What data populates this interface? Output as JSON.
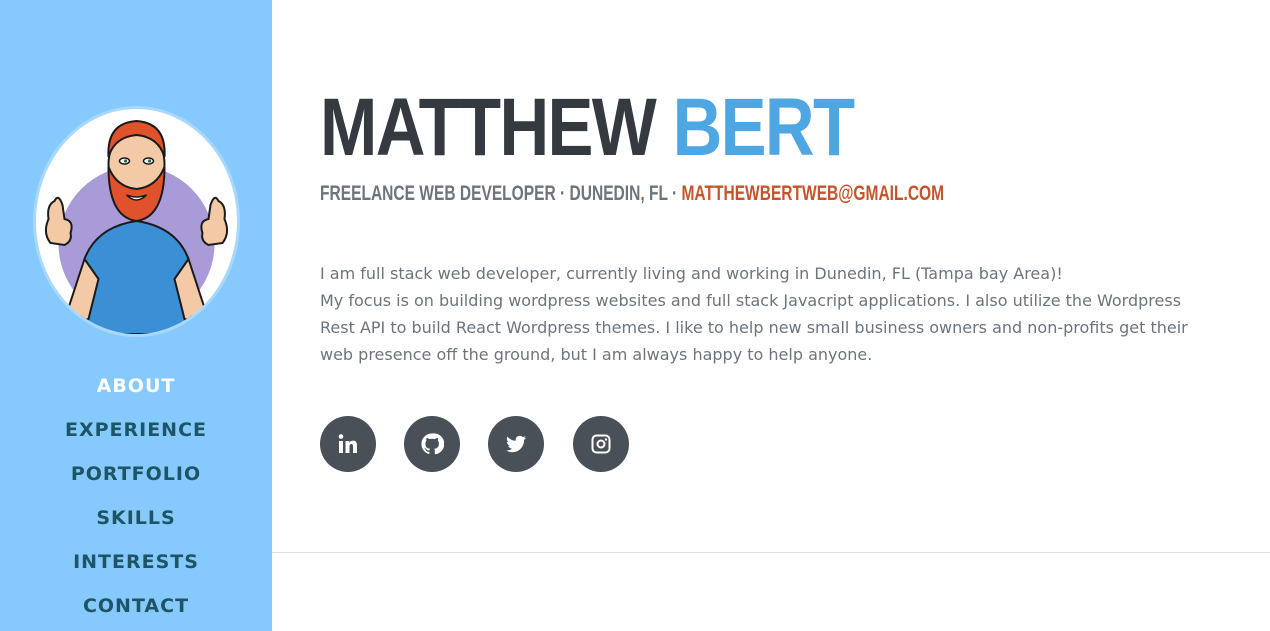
{
  "profile": {
    "first_name": "MATTHEW",
    "last_name": "BERT",
    "role_location": "FREELANCE WEB DEVELOPER · DUNEDIN, FL · ",
    "email": "MATTHEWBERTWEB@GMAIL.COM",
    "bio_line1": "I am full stack web developer, currently living and working in Dunedin, FL (Tampa bay Area)!",
    "bio_line2": "My focus is on building wordpress websites and full stack Javacript applications. I also utilize the Wordpress Rest API to build React Wordpress themes. I like to help new small business owners and non-profits get their web presence off the ground, but I am always happy to help anyone."
  },
  "nav": {
    "items": [
      {
        "label": "ABOUT",
        "active": true
      },
      {
        "label": "EXPERIENCE",
        "active": false
      },
      {
        "label": "PORTFOLIO",
        "active": false
      },
      {
        "label": "SKILLS",
        "active": false
      },
      {
        "label": "INTERESTS",
        "active": false
      },
      {
        "label": "CONTACT",
        "active": false
      }
    ]
  },
  "social": {
    "icons": [
      "linkedin-icon",
      "github-icon",
      "twitter-icon",
      "instagram-icon"
    ]
  },
  "colors": {
    "sidebar_bg": "#85c9fd",
    "nav_text": "#1d5566",
    "nav_active": "#ffffff",
    "name_dark": "#343a40",
    "name_accent": "#4ea6e2",
    "email_accent": "#c5532b",
    "body_text": "#6c757d",
    "social_bg": "#495057"
  }
}
